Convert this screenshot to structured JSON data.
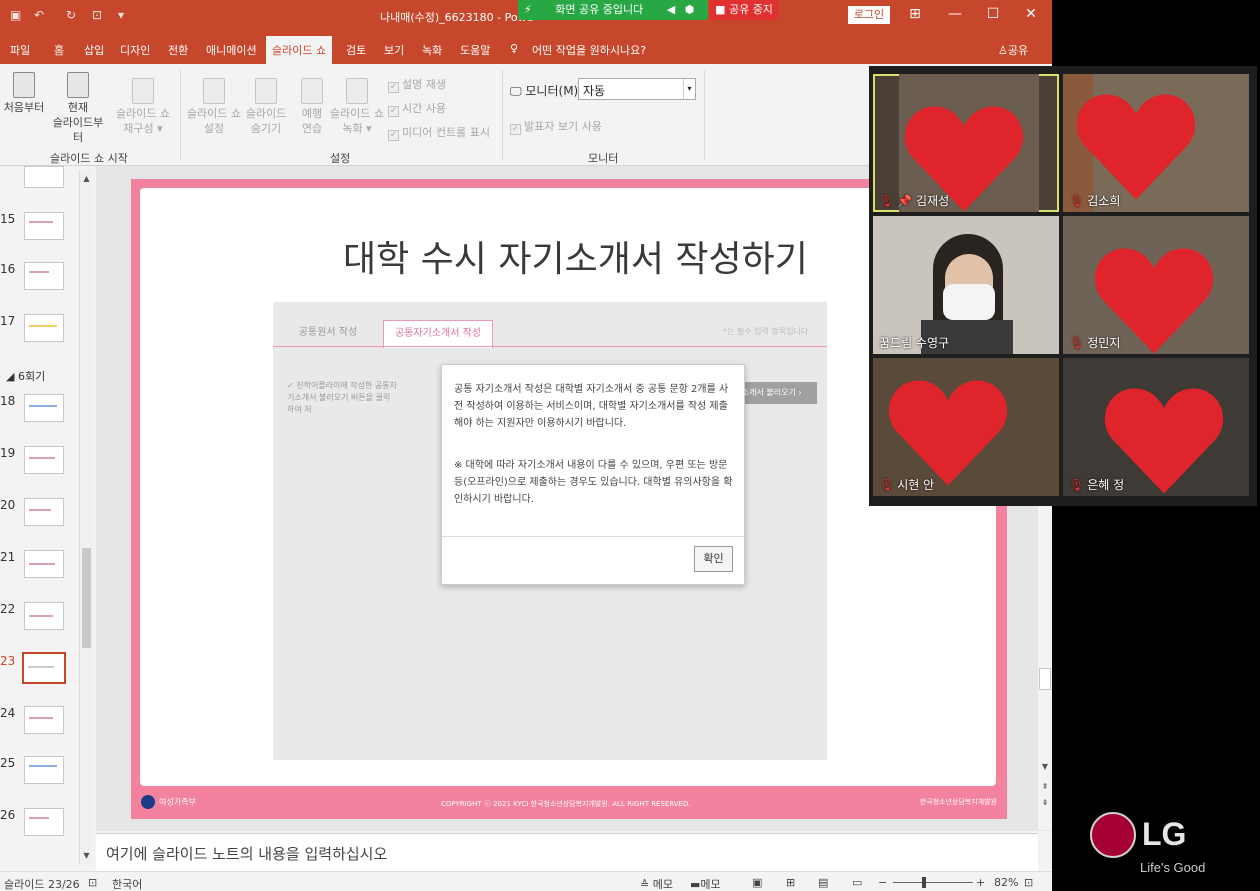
{
  "titlebar": {
    "title": "나내매(수정)_6623180  -  Powe",
    "login": "로그인",
    "share_status": "화면 공유 중입니다",
    "share_stop": "공유 중지"
  },
  "menu": {
    "items": [
      "파일",
      "홈",
      "삽입",
      "디자인",
      "전환",
      "애니메이션",
      "슬라이드 쇼",
      "검토",
      "보기",
      "녹화",
      "도움말"
    ],
    "active": "슬라이드 쇼",
    "tell_me": "어떤 작업을 원하시나요?",
    "share": "공유"
  },
  "ribbon": {
    "start_group": "슬라이드 쇼 시작",
    "from_start": "처음부터",
    "from_current_1": "현재",
    "from_current_2": "슬라이드부터",
    "custom_1": "슬라이드 쇼",
    "custom_2": "재구성 ▾",
    "setup_1": "슬라이드 쇼",
    "setup_2": "설정",
    "hide_1": "슬라이드",
    "hide_2": "숨기기",
    "rehearse_1": "예행",
    "rehearse_2": "연습",
    "record_1": "슬라이드 쇼",
    "record_2": "녹화 ▾",
    "narration": "설명 재생",
    "timings": "시간 사용",
    "media_controls": "미디어 컨트롤 표시",
    "settings_group": "설정",
    "monitor_label": "모니터(M):",
    "monitor_value": "자동",
    "presenter_view": "발표자 보기 사용",
    "monitor_group": "모니터"
  },
  "thumbs": {
    "section": "◢ 6회기",
    "numbers": [
      "15",
      "16",
      "17",
      "18",
      "19",
      "20",
      "21",
      "22",
      "23",
      "24",
      "25",
      "26"
    ]
  },
  "slide": {
    "title": "대학 수시 자기소개서 작성하기",
    "tab1": "공통원서 작성",
    "tab2": "공통자기소개서 작성",
    "tab_note": "*는 필수 입력 항목입니다.",
    "hint": "✓ 진학어플라이에 작성한 공통자기소개서 불러오기 버튼을 클릭하여 저",
    "load_button": "공통자기소개서 불러오기 ›",
    "footer_left": "여성가족부",
    "footer_copy": "COPYRIGHT ⓒ 2021 KYCI 한국청소년상담복지개발원. ALL RIGHT RESERVED.",
    "footer_right": "한국청소년상담복지개발원"
  },
  "modal": {
    "p1": "공통 자기소개서 작성은 대학별 자기소개서 중 공통 문항 2개를 사전 작성하여 이용하는 서비스이며, 대학별 자기소개서를 작성 제출해야 하는 지원자만 이용하시기 바랍니다.",
    "p2": "※ 대학에 따라 자기소개서 내용이 다를 수 있으며, 우편 또는 방문 등(오프라인)으로 제출하는 경우도 있습니다. 대학별 유의사항을 확인하시기 바랍니다.",
    "ok": "확인"
  },
  "notes_placeholder": "여기에 슬라이드 노트의 내용을 입력하십시오",
  "status": {
    "slide_counter": "슬라이드 23/26",
    "language": "한국어",
    "notes": "≙ 메모",
    "comments": "메모",
    "zoom": "82%"
  },
  "zoom": {
    "participants": [
      {
        "name": "김재성",
        "pinned": true,
        "highlight": true
      },
      {
        "name": "김소희"
      },
      {
        "name": "꿈드림 수영구"
      },
      {
        "name": "정민지"
      },
      {
        "name": "시현 안"
      },
      {
        "name": "은혜 정"
      }
    ]
  },
  "desktop": {
    "brand": "LG",
    "tagline": "Life's Good"
  },
  "colors": {
    "ppt_accent": "#c6472b",
    "slide_pink": "#f2829e",
    "heart": "#e0242b"
  }
}
